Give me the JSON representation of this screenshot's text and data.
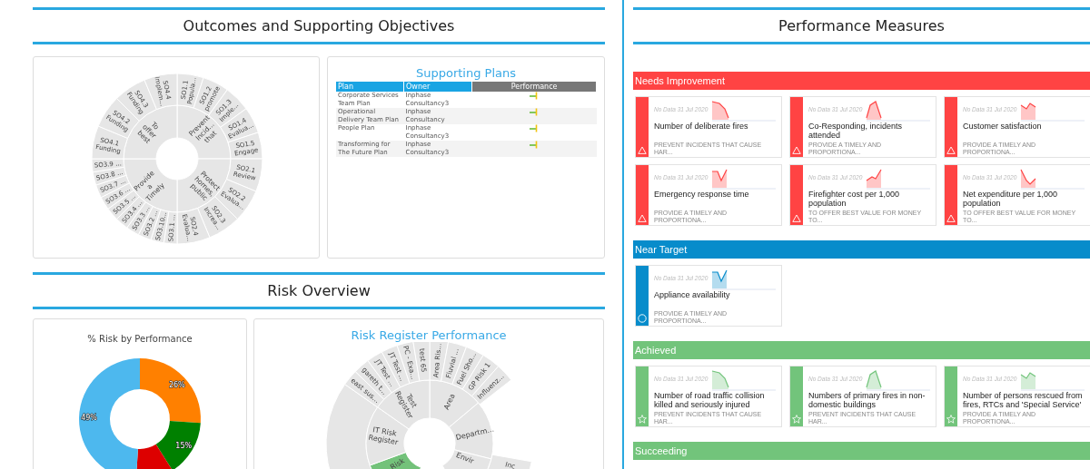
{
  "outcomes": {
    "title": "Outcomes and Supporting Objectives",
    "objectives_sunburst": [
      {
        "lines": [
          "Prevent",
          "Incid...",
          "that"
        ],
        "children": [
          {
            "lines": [
              "SO1.1",
              "Popula..."
            ]
          },
          {
            "lines": [
              "SO1.2",
              "promote"
            ]
          },
          {
            "lines": [
              "SO1.3",
              "Imple..."
            ]
          },
          {
            "lines": [
              "SO1.4",
              "Evalua..."
            ]
          },
          {
            "lines": [
              "SO1.5",
              "Engage"
            ]
          }
        ]
      },
      {
        "lines": [
          "Protect",
          "homes,",
          "public"
        ],
        "children": [
          {
            "lines": [
              "SO2.1",
              "Review"
            ]
          },
          {
            "lines": [
              "SO2.2",
              "Evalua..."
            ]
          },
          {
            "lines": [
              "SO2.3",
              "Increa..."
            ]
          },
          {
            "lines": [
              "SO2.4",
              "Evalua..."
            ]
          }
        ]
      },
      {
        "lines": [
          "Provide",
          "a",
          "Timely"
        ],
        "children": [
          {
            "lines": [
              "SO3.1 ..."
            ]
          },
          {
            "lines": [
              "SO3.10..."
            ]
          },
          {
            "lines": [
              "SO3.2 ..."
            ]
          },
          {
            "lines": [
              "SO3.3 ..."
            ]
          },
          {
            "lines": [
              "SO3.4 ..."
            ]
          },
          {
            "lines": [
              "SO3.5 ..."
            ]
          },
          {
            "lines": [
              "SO3.6 ..."
            ]
          },
          {
            "lines": [
              "SO3.7 ..."
            ]
          },
          {
            "lines": [
              "SO3.8 ..."
            ]
          },
          {
            "lines": [
              "SO3.9 ..."
            ]
          }
        ]
      },
      {
        "lines": [
          "To",
          "offer",
          "best"
        ],
        "children": [
          {
            "lines": [
              "SO4.1",
              "Funding"
            ]
          },
          {
            "lines": [
              "SO4.2",
              "Funding"
            ]
          },
          {
            "lines": [
              "SO4.3",
              "Funding"
            ]
          },
          {
            "lines": [
              "SO4.4",
              "Implem..."
            ]
          }
        ]
      }
    ],
    "supporting_plans": {
      "title": "Supporting Plans",
      "columns": [
        "Plan",
        "Owner",
        "Performance"
      ],
      "rows": [
        {
          "plan": "Corporate Services Team Plan",
          "owner": "Inphase Consultancy3"
        },
        {
          "plan": "Operational Delivery Team Plan",
          "owner": "Inphase Consultancy"
        },
        {
          "plan": "People Plan",
          "owner": "Inphase Consultancy3"
        },
        {
          "plan": "Transforming for The Future Plan",
          "owner": "Inphase Consultancy3"
        }
      ]
    }
  },
  "risk_overview": {
    "title": "Risk Overview",
    "risk_by_performance": {
      "chart_data": {
        "type": "donut",
        "title": "% Risk by Performance",
        "values": [
          26,
          15,
          10,
          49
        ],
        "colors": [
          "#ff8000",
          "#008000",
          "#dd0000",
          "#4db8ee"
        ],
        "value_labels": [
          "26%",
          "15%",
          null,
          "49%"
        ]
      }
    },
    "risk_register": {
      "title": "Risk Register Performance",
      "segments": [
        {
          "lines": [
            "Area"
          ],
          "color": "#e5e5e5",
          "children": [
            {
              "lines": [
                "Area Ris..."
              ]
            },
            {
              "lines": [
                "Fluvial ..."
              ]
            },
            {
              "lines": [
                "Fuel Sho..."
              ]
            },
            {
              "lines": [
                "GP Risk 1"
              ]
            },
            {
              "lines": [
                "Influenz..."
              ]
            }
          ]
        },
        {
          "lines": [
            "Departm..."
          ],
          "color": "#e5e5e5"
        },
        {
          "lines": [
            "Envir"
          ],
          "color": "#e5e5e5",
          "children": [
            {
              "lines": [
                "Inc"
              ]
            }
          ]
        },
        {
          "lines": [
            "Risk"
          ],
          "color": "#73c27a"
        },
        {
          "lines": [
            "IT Risk",
            "Register"
          ],
          "color": "#e5e5e5"
        },
        {
          "lines": [
            "Test",
            "Register"
          ],
          "color": "#e5e5e5",
          "children": [
            {
              "lines": [
                "east sus..."
              ]
            },
            {
              "lines": [
                "gareth t..."
              ]
            },
            {
              "lines": [
                "JT Test ..."
              ]
            },
            {
              "lines": [
                "JT Test ..."
              ]
            },
            {
              "lines": [
                "PC - Exa..."
              ]
            },
            {
              "lines": [
                "test 65"
              ]
            }
          ]
        }
      ]
    }
  },
  "performance_measures": {
    "title": "Performance Measures",
    "groups": [
      {
        "name": "Needs Improvement",
        "kind": "warning",
        "color": "#ff4343",
        "cards": [
          {
            "date": "No Data 31 Jul 2020",
            "title": "Number of deliberate fires",
            "objective": "PREVENT INCIDENTS THAT CAUSE HAR..."
          },
          {
            "date": "No Data 31 Jul 2020",
            "title": "Co-Responding, incidents attended",
            "objective": "PROVIDE A TIMELY AND PROPORTIONA..."
          },
          {
            "date": "No Data 31 Jul 2020",
            "title": "Customer satisfaction",
            "objective": "PROVIDE A TIMELY AND PROPORTIONA..."
          },
          {
            "date": "No Data 31 Jul 2020",
            "title": "Emergency response time",
            "objective": "PROVIDE A TIMELY AND PROPORTIONA..."
          },
          {
            "date": "No Data 31 Jul 2020",
            "title": "Firefighter cost per 1,000 population",
            "objective": "TO OFFER BEST VALUE FOR MONEY TO..."
          },
          {
            "date": "No Data 31 Jul 2020",
            "title": "Net expenditure per 1,000 population",
            "objective": "TO OFFER BEST VALUE FOR MONEY TO..."
          }
        ]
      },
      {
        "name": "Near Target",
        "kind": "near",
        "color": "#078ccb",
        "cards": [
          {
            "date": "No Data 31 Jul 2020",
            "title": "Appliance availability",
            "objective": "PROVIDE A TIMELY AND PROPORTIONA..."
          }
        ]
      },
      {
        "name": "Achieved",
        "kind": "achieved",
        "color": "#72c47b",
        "cards": [
          {
            "date": "No Data 31 Jul 2020",
            "title": "Number of road traffic collision killed and seriously injured",
            "objective": "PREVENT INCIDENTS THAT CAUSE HAR..."
          },
          {
            "date": "No Data 31 Jul 2020",
            "title": "Numbers of primary fires in non-domestic buildings",
            "objective": "PREVENT INCIDENTS THAT CAUSE HAR..."
          },
          {
            "date": "No Data 31 Jul 2020",
            "title": "Number of persons rescued from fires, RTCs and 'Special Service'",
            "objective": "PROVIDE A TIMELY AND PROPORTIONA..."
          }
        ]
      },
      {
        "name": "Succeeding",
        "color": "#72c47b"
      }
    ]
  }
}
